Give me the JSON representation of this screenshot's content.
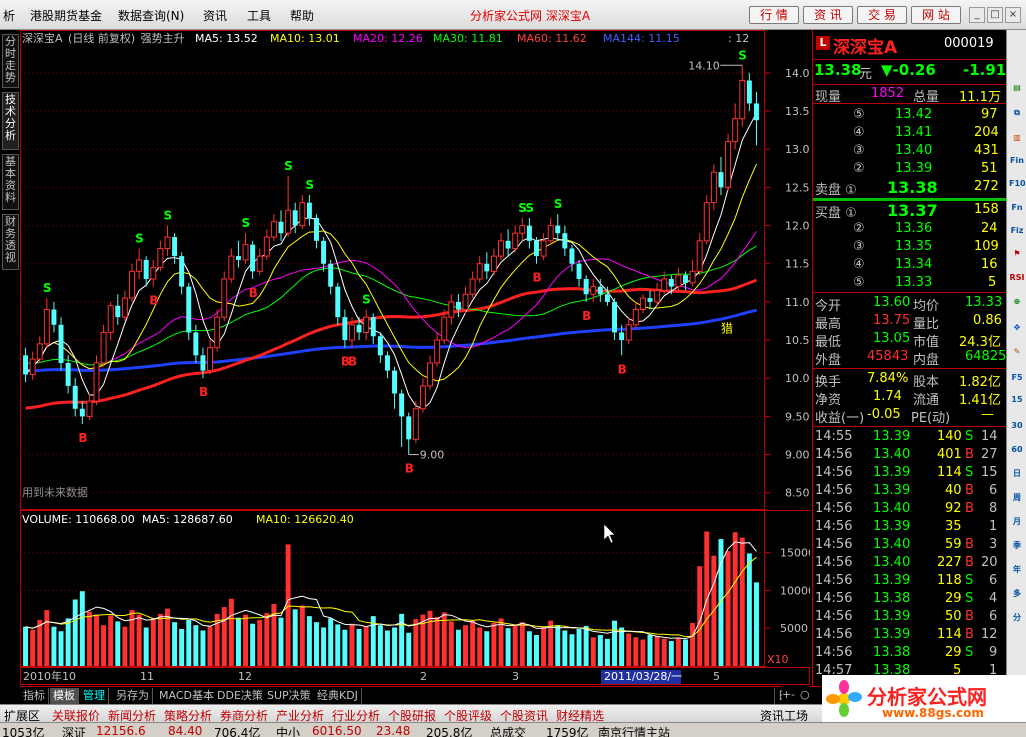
{
  "menu": {
    "items": [
      "析",
      "港股期货基金",
      "数据查询(N)",
      "资讯",
      "工具",
      "帮助"
    ],
    "title": "分析家公式网  深深宝A",
    "buttons": [
      "行 情",
      "资 讯",
      "交 易",
      "网 站"
    ]
  },
  "left_tabs": [
    "分时走势",
    "技术分析",
    "基本资料",
    "财务透视"
  ],
  "chart_header": {
    "name": "深深宝A",
    "period": "(日线 前复权)",
    "formula": "强势主升",
    "ma5": "MA5: 13.52",
    "ma10": "MA10: 13.01",
    "ma20": "MA20: 12.26",
    "ma30": "MA30: 11.81",
    "ma60": "MA60: 11.62",
    "ma144": "MA144: 11.15",
    "extra": ": 12"
  },
  "colors": {
    "ma5": "#ffffff",
    "ma10": "#ffff00",
    "ma20": "#ff00ff",
    "ma30": "#00ff00",
    "ma60": "#ff2020",
    "ma144": "#2040ff",
    "up": "#ff3030",
    "down": "#54ffff"
  },
  "price_axis": [
    "14.00",
    "13.50",
    "13.00",
    "12.50",
    "12.00",
    "11.50",
    "11.00",
    "10.50",
    "10.00",
    "9.50",
    "9.00",
    "8.50"
  ],
  "annotations": {
    "high": "14.10",
    "low": "9.00",
    "future": "用到未来数据",
    "lie": "猎"
  },
  "volume_header": {
    "label": "VOLUME: 110668.00",
    "ma5": "MA5: 128687.60",
    "ma10": "MA10: 126620.40"
  },
  "volume_axis": [
    "15000",
    "10000",
    "5000"
  ],
  "volume_unit": "X10",
  "date_axis": [
    "2010年10",
    "11",
    "12",
    "2",
    "3",
    "5"
  ],
  "date_cursor": "2011/03/28/一",
  "chart_data": [
    {
      "type": "candlestick",
      "title": "深深宝A (日线 前复权)",
      "ylim": [
        8.3,
        14.3
      ],
      "series": [
        {
          "name": "price",
          "values": [
            [
              10.3,
              10.05,
              10.4,
              9.95
            ],
            [
              10.05,
              10.25,
              10.35,
              9.98
            ],
            [
              10.25,
              10.45,
              10.55,
              10.2
            ],
            [
              10.45,
              10.9,
              11.05,
              10.4
            ],
            [
              10.9,
              10.7,
              11.0,
              10.6
            ],
            [
              10.7,
              10.2,
              10.8,
              10.1
            ],
            [
              10.2,
              9.9,
              10.3,
              9.8
            ],
            [
              9.9,
              9.6,
              10.0,
              9.5
            ],
            [
              9.6,
              9.5,
              9.7,
              9.4
            ],
            [
              9.5,
              9.7,
              9.8,
              9.45
            ],
            [
              9.7,
              10.2,
              10.3,
              9.65
            ],
            [
              10.2,
              10.6,
              10.7,
              10.15
            ],
            [
              10.6,
              10.95,
              11.0,
              10.5
            ],
            [
              10.95,
              10.8,
              11.1,
              10.7
            ],
            [
              10.8,
              11.05,
              11.15,
              10.75
            ],
            [
              11.05,
              11.4,
              11.5,
              11.0
            ],
            [
              11.4,
              11.55,
              11.7,
              11.3
            ],
            [
              11.55,
              11.3,
              11.6,
              11.2
            ],
            [
              11.3,
              11.45,
              11.55,
              11.2
            ],
            [
              11.45,
              11.7,
              11.8,
              11.4
            ],
            [
              11.7,
              11.85,
              12.0,
              11.6
            ],
            [
              11.85,
              11.6,
              11.9,
              11.5
            ],
            [
              11.6,
              11.2,
              11.65,
              11.1
            ],
            [
              11.2,
              10.6,
              11.25,
              10.5
            ],
            [
              10.6,
              10.3,
              10.7,
              10.2
            ],
            [
              10.3,
              10.1,
              10.4,
              10.0
            ],
            [
              10.1,
              10.4,
              10.5,
              10.05
            ],
            [
              10.4,
              10.8,
              10.9,
              10.35
            ],
            [
              10.8,
              11.3,
              11.4,
              10.75
            ],
            [
              11.3,
              11.6,
              11.7,
              11.25
            ],
            [
              11.6,
              11.55,
              11.8,
              11.45
            ],
            [
              11.55,
              11.75,
              11.9,
              11.5
            ],
            [
              11.75,
              11.4,
              11.8,
              11.3
            ],
            [
              11.4,
              11.6,
              11.7,
              11.35
            ],
            [
              11.6,
              11.85,
              11.95,
              11.55
            ],
            [
              11.85,
              12.05,
              12.15,
              11.8
            ],
            [
              12.05,
              11.9,
              12.2,
              11.8
            ],
            [
              11.9,
              12.2,
              12.65,
              11.85
            ],
            [
              12.2,
              12.0,
              12.3,
              11.9
            ],
            [
              12.0,
              12.3,
              12.4,
              11.95
            ],
            [
              12.3,
              12.1,
              12.4,
              12.0
            ],
            [
              12.1,
              11.8,
              12.15,
              11.7
            ],
            [
              11.8,
              11.5,
              11.85,
              11.4
            ],
            [
              11.5,
              11.2,
              11.55,
              11.1
            ],
            [
              11.2,
              10.8,
              11.25,
              10.7
            ],
            [
              10.8,
              10.5,
              10.9,
              10.4
            ],
            [
              10.5,
              10.7,
              10.8,
              10.4
            ],
            [
              10.7,
              10.6,
              10.8,
              10.5
            ],
            [
              10.6,
              10.8,
              10.9,
              10.5
            ],
            [
              10.8,
              10.55,
              10.85,
              10.45
            ],
            [
              10.55,
              10.3,
              10.6,
              10.2
            ],
            [
              10.3,
              10.1,
              10.35,
              10.0
            ],
            [
              10.1,
              9.8,
              10.15,
              9.6
            ],
            [
              9.8,
              9.5,
              9.85,
              9.1
            ],
            [
              9.5,
              9.2,
              9.55,
              9.0
            ],
            [
              9.2,
              9.6,
              9.7,
              9.15
            ],
            [
              9.6,
              9.9,
              10.0,
              9.55
            ],
            [
              9.9,
              10.2,
              10.3,
              9.85
            ],
            [
              10.2,
              10.5,
              10.6,
              10.15
            ],
            [
              10.5,
              10.8,
              10.9,
              10.45
            ],
            [
              10.8,
              11.0,
              11.1,
              10.7
            ],
            [
              11.0,
              10.9,
              11.1,
              10.8
            ],
            [
              10.9,
              11.1,
              11.2,
              10.85
            ],
            [
              11.1,
              11.3,
              11.4,
              11.05
            ],
            [
              11.3,
              11.5,
              11.6,
              11.25
            ],
            [
              11.5,
              11.4,
              11.65,
              11.3
            ],
            [
              11.4,
              11.6,
              11.7,
              11.35
            ],
            [
              11.6,
              11.8,
              11.9,
              11.55
            ],
            [
              11.8,
              11.7,
              11.95,
              11.6
            ],
            [
              11.7,
              11.9,
              12.0,
              11.65
            ],
            [
              11.9,
              12.0,
              12.1,
              11.8
            ],
            [
              12.0,
              11.8,
              12.1,
              11.7
            ],
            [
              11.8,
              11.6,
              11.85,
              11.5
            ],
            [
              11.6,
              11.8,
              11.9,
              11.55
            ],
            [
              11.8,
              12.0,
              12.1,
              11.75
            ],
            [
              12.0,
              11.9,
              12.15,
              11.8
            ],
            [
              11.9,
              11.7,
              12.0,
              11.6
            ],
            [
              11.7,
              11.5,
              11.75,
              11.4
            ],
            [
              11.5,
              11.3,
              11.55,
              11.2
            ],
            [
              11.3,
              11.1,
              11.35,
              11.0
            ],
            [
              11.1,
              11.2,
              11.3,
              11.0
            ],
            [
              11.2,
              11.1,
              11.3,
              11.0
            ],
            [
              11.1,
              11.0,
              11.2,
              10.95
            ],
            [
              11.0,
              10.6,
              11.05,
              10.5
            ],
            [
              10.6,
              10.5,
              10.7,
              10.3
            ],
            [
              10.5,
              10.7,
              10.8,
              10.45
            ],
            [
              10.7,
              10.9,
              11.0,
              10.65
            ],
            [
              10.9,
              11.05,
              11.1,
              10.85
            ],
            [
              11.05,
              11.0,
              11.15,
              10.9
            ],
            [
              11.0,
              11.15,
              11.25,
              10.95
            ],
            [
              11.15,
              11.3,
              11.4,
              11.1
            ],
            [
              11.3,
              11.2,
              11.35,
              11.1
            ],
            [
              11.2,
              11.35,
              11.45,
              11.15
            ],
            [
              11.35,
              11.25,
              11.4,
              11.15
            ],
            [
              11.25,
              11.4,
              11.55,
              11.2
            ],
            [
              11.4,
              11.8,
              11.9,
              11.35
            ],
            [
              11.8,
              12.3,
              12.4,
              11.75
            ],
            [
              12.3,
              12.7,
              12.8,
              12.2
            ],
            [
              12.7,
              12.5,
              12.9,
              12.4
            ],
            [
              12.5,
              13.1,
              13.2,
              12.45
            ],
            [
              13.1,
              13.4,
              13.6,
              13.0
            ],
            [
              13.4,
              13.9,
              14.1,
              13.3
            ],
            [
              13.9,
              13.6,
              14.0,
              13.5
            ],
            [
              13.6,
              13.38,
              13.75,
              13.05
            ]
          ]
        }
      ]
    },
    {
      "type": "bar",
      "title": "VOLUME",
      "ylim": [
        0,
        18000
      ],
      "series": [
        {
          "name": "VOLUME",
          "values": [
            5200,
            4800,
            6100,
            7400,
            5200,
            4600,
            6300,
            8800,
            9900,
            7200,
            6800,
            5400,
            6700,
            5900,
            5200,
            7400,
            6800,
            5100,
            6300,
            6900,
            7600,
            5800,
            4900,
            6100,
            5400,
            4700,
            5200,
            6900,
            7800,
            8900,
            6400,
            6800,
            5600,
            6100,
            7000,
            8200,
            6400,
            16100,
            7500,
            8000,
            6600,
            5800,
            5100,
            6300,
            5500,
            4800,
            5600,
            4900,
            5300,
            6600,
            5400,
            4700,
            5100,
            6900,
            4400,
            6200,
            6800,
            7300,
            6500,
            7100,
            5900,
            4800,
            5400,
            6000,
            5100,
            4600,
            5700,
            6300,
            5000,
            5400,
            5800,
            4600,
            4100,
            5200,
            6000,
            5400,
            4700,
            4200,
            4900,
            5300,
            3800,
            4100,
            3600,
            6000,
            5100,
            4300,
            3800,
            3500,
            4100,
            3900,
            3600,
            3300,
            3700,
            3500,
            5700,
            13200,
            17800,
            14600,
            16800,
            15200,
            17700,
            17000,
            14900,
            11067
          ]
        }
      ]
    }
  ],
  "panel": {
    "name": "深深宝A",
    "code": "000019",
    "badge": "L",
    "price": "13.38",
    "yuan": "元",
    "change": "▼-0.26",
    "pct": "-1.91",
    "vol_label": "现量",
    "vol": "1852",
    "total_label": "总量",
    "total": "11.1万",
    "sells": [
      {
        "lvl": "⑤",
        "p": "13.42",
        "v": "97"
      },
      {
        "lvl": "④",
        "p": "13.41",
        "v": "204"
      },
      {
        "lvl": "③",
        "p": "13.40",
        "v": "431"
      },
      {
        "lvl": "②",
        "p": "13.39",
        "v": "51"
      },
      {
        "lvl": "卖盘 ①",
        "p": "13.38",
        "v": "272"
      }
    ],
    "buys": [
      {
        "lvl": "买盘 ①",
        "p": "13.37",
        "v": "158"
      },
      {
        "lvl": "②",
        "p": "13.36",
        "v": "24"
      },
      {
        "lvl": "③",
        "p": "13.35",
        "v": "109"
      },
      {
        "lvl": "④",
        "p": "13.34",
        "v": "16"
      },
      {
        "lvl": "⑤",
        "p": "13.33",
        "v": "5"
      }
    ],
    "stats": [
      {
        "a": "今开",
        "av": "13.60",
        "b": "均价",
        "bv": "13.33"
      },
      {
        "a": "最高",
        "av": "13.75",
        "b": "量比",
        "bv": "0.86"
      },
      {
        "a": "最低",
        "av": "13.05",
        "b": "市值",
        "bv": "24.3亿"
      },
      {
        "a": "外盘",
        "av": "45843",
        "b": "内盘",
        "bv": "64825"
      },
      {
        "a": "换手",
        "av": "7.84%",
        "b": "股本",
        "bv": "1.82亿"
      },
      {
        "a": "净资",
        "av": "1.74",
        "b": "流通",
        "bv": "1.41亿"
      },
      {
        "a": "收益(一)",
        "av": "-0.05",
        "b": "PE(动)",
        "bv": "—"
      }
    ],
    "ticks": [
      {
        "t": "14:55",
        "p": "13.39",
        "v": "140",
        "s": "S",
        "n": "14"
      },
      {
        "t": "14:56",
        "p": "13.40",
        "v": "401",
        "s": "B",
        "n": "27"
      },
      {
        "t": "14:56",
        "p": "13.39",
        "v": "114",
        "s": "S",
        "n": "15"
      },
      {
        "t": "14:56",
        "p": "13.39",
        "v": "40",
        "s": "B",
        "n": "6"
      },
      {
        "t": "14:56",
        "p": "13.40",
        "v": "92",
        "s": "B",
        "n": "8"
      },
      {
        "t": "14:56",
        "p": "13.39",
        "v": "35",
        "s": "",
        "n": "1"
      },
      {
        "t": "14:56",
        "p": "13.40",
        "v": "59",
        "s": "B",
        "n": "3"
      },
      {
        "t": "14:56",
        "p": "13.40",
        "v": "227",
        "s": "B",
        "n": "20"
      },
      {
        "t": "14:56",
        "p": "13.39",
        "v": "118",
        "s": "S",
        "n": "6"
      },
      {
        "t": "14:56",
        "p": "13.38",
        "v": "29",
        "s": "S",
        "n": "4"
      },
      {
        "t": "14:56",
        "p": "13.39",
        "v": "50",
        "s": "B",
        "n": "6"
      },
      {
        "t": "14:56",
        "p": "13.39",
        "v": "114",
        "s": "B",
        "n": "12"
      },
      {
        "t": "14:56",
        "p": "13.38",
        "v": "29",
        "s": "S",
        "n": "9"
      },
      {
        "t": "14:57",
        "p": "13.38",
        "v": "5",
        "s": "",
        "n": "1"
      }
    ],
    "tab_daily": "日线",
    "nav": [
      "+",
      "-",
      "○"
    ]
  },
  "bottom_tabs": [
    "指标",
    "模板",
    "管理",
    "另存为",
    "MACD基本",
    "DDE决策",
    "SUP决策",
    "经典KDJ"
  ],
  "taskbar": [
    "扩展区",
    "关联报价",
    "新闻分析",
    "策略分析",
    "券商分析",
    "产业分析",
    "行业分析",
    "个股研报",
    "个股评级",
    "个股资讯",
    "财经精选",
    "资讯工场"
  ],
  "status": [
    "1053亿",
    "深证",
    "12156.6",
    "84.40",
    "706.4亿",
    "中小",
    "6016.50",
    "23.48",
    "205.8亿",
    "总成交",
    "1759亿",
    "南京行情主站"
  ],
  "logo_text": "分析家公式网",
  "logo_url": "www.88gs.com"
}
